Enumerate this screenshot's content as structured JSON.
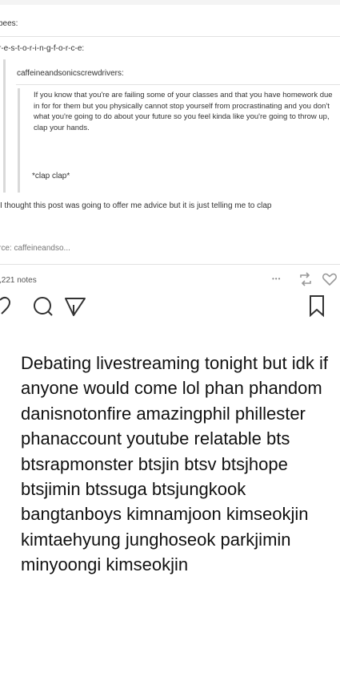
{
  "post": {
    "user1": "bees:",
    "user2": "r-e-s-t-o-r-i-n-g-f-o-r-c-e:",
    "user3": "caffeineandsonicscrewdrivers:",
    "quote": "If you know that you're are failing some of your classes and that you have homework due in for for them but you physically cannot stop yourself from procrastinating and you don't what you're going to do about your future so you feel kinda like you're going to throw up, clap your hands.",
    "clap": "*clap clap*",
    "reply": "I thought this post was going to offer me advice but it is just telling me to clap",
    "source": "rce: caffeineandso...",
    "notes": ",221 notes",
    "more": "•••"
  },
  "caption": "Debating livestreaming tonight but idk if anyone would come lol phan phandom danisnotonfire amazingphil phillester phanaccount youtube relatable bts btsrapmonster btsjin btsv btsjhope btsjimin btssuga btsjungkook bangtanboys kimnamjoon kimseokjin kimtaehyung junghoseok parkjimin minyoongi kimseokjin",
  "icons": [
    "heart-icon",
    "comment-icon",
    "share-icon",
    "more-icon",
    "reblog-icon",
    "like-icon",
    "bookmark-icon"
  ]
}
